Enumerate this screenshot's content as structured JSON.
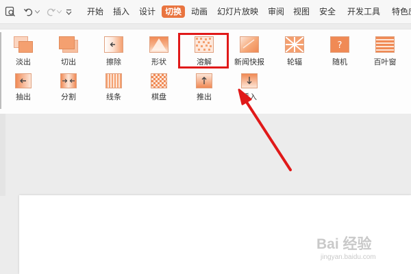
{
  "menubar": {
    "tabs": [
      {
        "label": "开始"
      },
      {
        "label": "插入"
      },
      {
        "label": "设计"
      },
      {
        "label": "切换",
        "active": true
      },
      {
        "label": "动画"
      },
      {
        "label": "幻灯片放映"
      },
      {
        "label": "审阅"
      },
      {
        "label": "视图"
      },
      {
        "label": "安全"
      },
      {
        "label": "开发工具"
      },
      {
        "label": "特色应"
      }
    ],
    "active_color": "#e9743f",
    "quick_icons": [
      "print-preview-icon",
      "undo-icon",
      "undo-dropdown-icon",
      "redo-icon",
      "redo-dropdown-icon",
      "customize-quick-access-icon"
    ]
  },
  "ribbon": {
    "row1": [
      {
        "label": "淡出",
        "icon": "fade-icon"
      },
      {
        "label": "切出",
        "icon": "cut-out-icon"
      },
      {
        "label": "擦除",
        "icon": "wipe-icon"
      },
      {
        "label": "形状",
        "icon": "shape-icon"
      },
      {
        "label": "溶解",
        "icon": "dissolve-icon",
        "highlighted": true
      },
      {
        "label": "新闻快报",
        "icon": "newsflash-icon"
      },
      {
        "label": "轮辐",
        "icon": "wheel-icon"
      },
      {
        "label": "随机",
        "icon": "random-icon"
      },
      {
        "label": "百叶窗",
        "icon": "blinds-icon"
      }
    ],
    "row2": [
      {
        "label": "抽出",
        "icon": "pull-out-icon"
      },
      {
        "label": "分割",
        "icon": "split-icon"
      },
      {
        "label": "线条",
        "icon": "lines-icon"
      },
      {
        "label": "棋盘",
        "icon": "checkerboard-icon"
      },
      {
        "label": "推出",
        "icon": "push-icon"
      },
      {
        "label": "插入",
        "icon": "cover-icon"
      }
    ],
    "icon_color": "#f0925f",
    "highlight_color": "#e01919"
  },
  "watermark": {
    "main": "Bai 经验",
    "sub": "jingyan.baidu.com"
  }
}
